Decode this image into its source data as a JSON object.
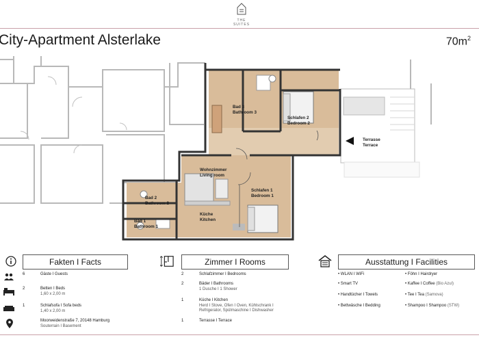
{
  "brand": {
    "name": "THE SUITES"
  },
  "header": {
    "title": "City-Apartment Alsterlake",
    "area": "70m",
    "area_sup": "2"
  },
  "plan": {
    "rooms": {
      "bad3": [
        "Bad 3",
        "Bathroom 3"
      ],
      "schlafen2": [
        "Schlafen 2",
        "Bedroom 2"
      ],
      "terrasse": [
        "Terrasse",
        "Terrace"
      ],
      "wohnzimmer": [
        "Wohnzimmer",
        "Living room"
      ],
      "schlafen1": [
        "Schlafen 1",
        "Bedroom 1"
      ],
      "bad2": [
        "Bad 2",
        "Bathroom 2"
      ],
      "bad1": [
        "Bad 1",
        "Bathroom 1"
      ],
      "kueche": [
        "Küche",
        "Kitchen"
      ]
    }
  },
  "facts": {
    "heading": "Fakten I Facts",
    "items": [
      {
        "icon": "guests-icon",
        "num": "6",
        "text": "Gäste I Guests",
        "sub": ""
      },
      {
        "icon": "bed-icon",
        "num": "2",
        "text": "Betten I Beds",
        "sub": "1,60 x 2,00 m"
      },
      {
        "icon": "sofa-icon",
        "num": "1",
        "text": "Schlafsofa I Sofa beds",
        "sub": "1,40 x 2,00 m"
      },
      {
        "icon": "location-pin-icon",
        "num": "",
        "text": "Moorweidenstraße 7, 20148 Hamburg",
        "sub": "Souterrain I Basement"
      }
    ]
  },
  "rooms": {
    "heading": "Zimmer I Rooms",
    "items": [
      {
        "num": "2",
        "text": "Schlafzimmer I Bedrooms",
        "sub": ""
      },
      {
        "num": "2",
        "text": "Bäder I Bathrooms",
        "sub": "1 Dusche I 1 Shower"
      },
      {
        "num": "1",
        "text": "Küche I Kitchen",
        "sub": "Herd I Stove, Ofen I Oven, Kühlschrank I",
        "sub2": "Refrigerator, Spülmaschine I Dishwasher"
      },
      {
        "num": "1",
        "text": "Terrasse I Terrace",
        "sub": ""
      }
    ]
  },
  "facilities": {
    "heading": "Ausstattung I Facilities",
    "left": [
      {
        "text": "WLAN I WiFi",
        "extra": ""
      },
      {
        "text": "Smart TV",
        "extra": ""
      },
      {
        "text": "Handtücher I Towels",
        "extra": ""
      },
      {
        "text": "Bettwäsche I Bedding",
        "extra": ""
      }
    ],
    "right": [
      {
        "text": "Föhn I Hairdryer",
        "extra": ""
      },
      {
        "text": "Kaffee I Coffee",
        "extra": "(Bio Azul)"
      },
      {
        "text": "Tee I Tea",
        "extra": "(Samova)"
      },
      {
        "text": "Shampoo I Shampoo",
        "extra": "(STW)"
      }
    ]
  },
  "colors": {
    "accent": "#c9a0a8",
    "wood": "#d9bc9a",
    "wall": "#3a3a3a",
    "context": "#bdbdbd"
  }
}
